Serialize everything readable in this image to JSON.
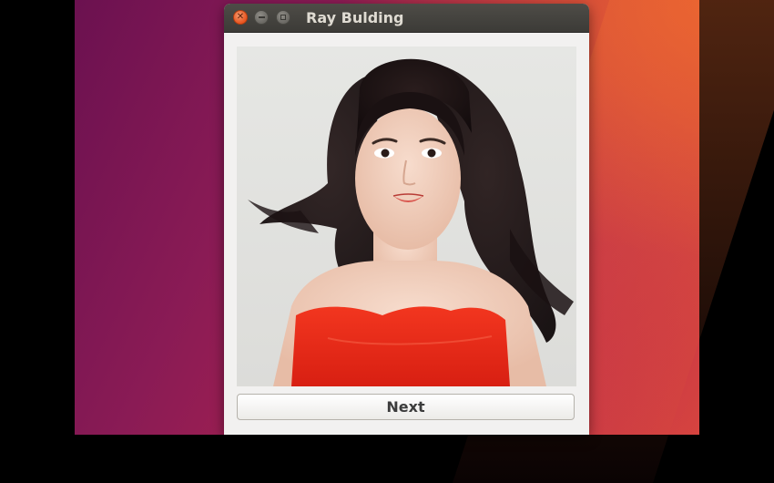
{
  "window": {
    "title": "Ray Bulding",
    "controls": {
      "close_icon": "close-icon",
      "minimize_icon": "minimize-icon",
      "maximize_icon": "maximize-icon"
    }
  },
  "content": {
    "image_description_icon": "portrait-photo",
    "next_label": "Next"
  },
  "colors": {
    "close_button": "#e8541f",
    "titlebar": "#3c3b37",
    "title_text": "#dfdbd2",
    "dress": "#e8291c"
  }
}
